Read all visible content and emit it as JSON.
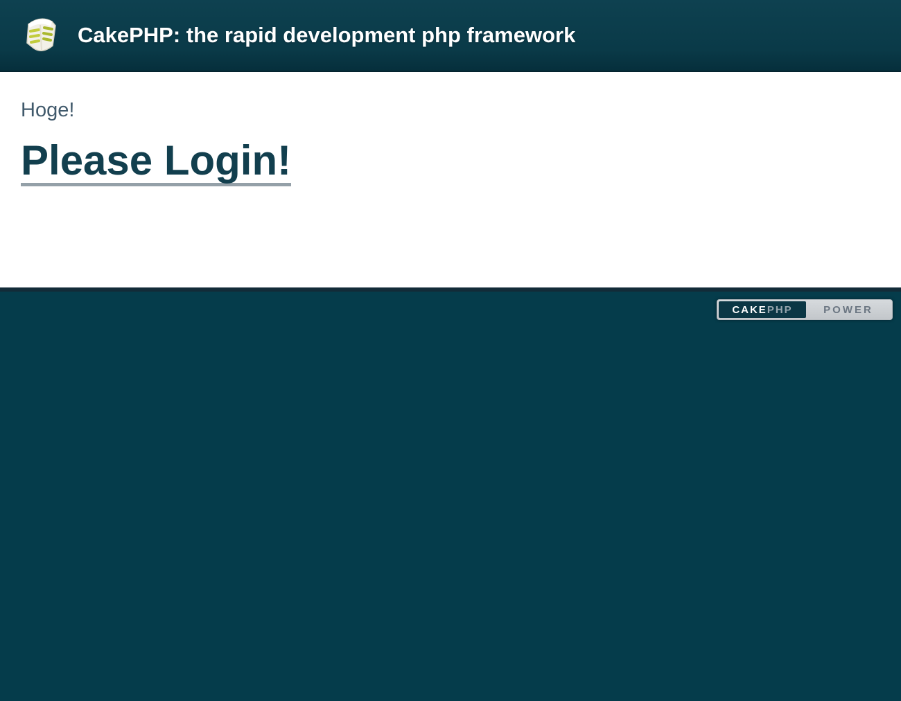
{
  "header": {
    "title": "CakePHP: the rapid development php framework",
    "logo_icon": "cake-slice-icon"
  },
  "content": {
    "flash_message": "Hoge!",
    "login_heading": {
      "link_label": "Please Login!"
    }
  },
  "footer": {
    "power_badge": {
      "left_primary": "CAKE",
      "left_secondary": "PHP",
      "right_label": "POWER"
    }
  },
  "colors": {
    "header_teal": "#0a3a48",
    "body_teal": "#053c4b",
    "footer_border": "#122b38",
    "title_text": "#ffffff",
    "flash_text": "#40596b",
    "heading_link": "#123f4e",
    "heading_underline": "#94a0a8",
    "badge_silver": "#c9cdd1",
    "badge_dark_panel": "#0b3745",
    "badge_power_text": "#6b7682",
    "logo_cream": "#f3f1e8",
    "logo_layer_green": "#c2cc3c"
  }
}
